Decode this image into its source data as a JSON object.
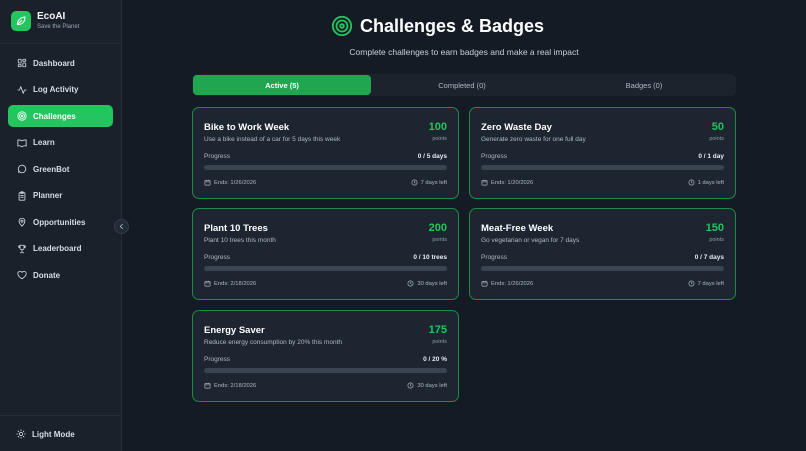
{
  "brand": {
    "name": "EcoAI",
    "tagline": "Save the Planet",
    "icon": "leaf-icon"
  },
  "sidebar": {
    "items": [
      {
        "label": "Dashboard",
        "icon": "grid-icon",
        "active": false
      },
      {
        "label": "Log Activity",
        "icon": "activity-icon",
        "active": false
      },
      {
        "label": "Challenges",
        "icon": "target-icon",
        "active": true
      },
      {
        "label": "Learn",
        "icon": "book-icon",
        "active": false
      },
      {
        "label": "GreenBot",
        "icon": "chat-icon",
        "active": false
      },
      {
        "label": "Planner",
        "icon": "clipboard-icon",
        "active": false
      },
      {
        "label": "Opportunities",
        "icon": "map-pin-icon",
        "active": false
      },
      {
        "label": "Leaderboard",
        "icon": "trophy-icon",
        "active": false
      },
      {
        "label": "Donate",
        "icon": "heart-icon",
        "active": false
      }
    ],
    "light_mode_label": "Light Mode"
  },
  "header": {
    "title": "Challenges & Badges",
    "subtitle": "Complete challenges to earn badges and make a real impact"
  },
  "tabs": [
    {
      "label": "Active (5)",
      "active": true
    },
    {
      "label": "Completed (0)",
      "active": false
    },
    {
      "label": "Badges (0)",
      "active": false
    }
  ],
  "challenges": [
    {
      "title": "Bike to Work Week",
      "description": "Use a bike instead of a car for 5 days this week",
      "points": "100",
      "points_label": "points",
      "progress_label": "Progress",
      "progress_text": "0 / 5 days",
      "progress": 0,
      "ends": "Ends: 1/26/2026",
      "time_left": "7 days left"
    },
    {
      "title": "Zero Waste Day",
      "description": "Generate zero waste for one full day",
      "points": "50",
      "points_label": "points",
      "progress_label": "Progress",
      "progress_text": "0 / 1 day",
      "progress": 0,
      "ends": "Ends: 1/20/2026",
      "time_left": "1 days left"
    },
    {
      "title": "Plant 10 Trees",
      "description": "Plant 10 trees this month",
      "points": "200",
      "points_label": "points",
      "progress_label": "Progress",
      "progress_text": "0 / 10 trees",
      "progress": 0,
      "ends": "Ends: 2/18/2026",
      "time_left": "30 days left"
    },
    {
      "title": "Meat-Free Week",
      "description": "Go vegetarian or vegan for 7 days",
      "points": "150",
      "points_label": "points",
      "progress_label": "Progress",
      "progress_text": "0 / 7 days",
      "progress": 0,
      "ends": "Ends: 1/26/2026",
      "time_left": "7 days left"
    },
    {
      "title": "Energy Saver",
      "description": "Reduce energy consumption by 20% this month",
      "points": "175",
      "points_label": "points",
      "progress_label": "Progress",
      "progress_text": "0 / 20 %",
      "progress": 0,
      "ends": "Ends: 2/18/2026",
      "time_left": "30 days left"
    }
  ],
  "colors": {
    "accent": "#22c55e",
    "background": "#141b24",
    "card": "#1d2530"
  }
}
